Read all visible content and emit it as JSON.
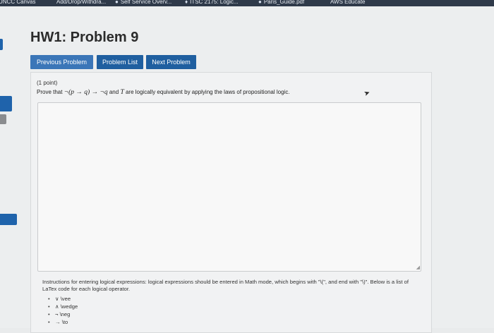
{
  "bookmarks": [
    {
      "label": "UNCC Canvas",
      "icon": "none"
    },
    {
      "label": "Add/Drop/Withdra...",
      "icon": "none"
    },
    {
      "label": "Self Service Overv...",
      "icon": "circle-icon"
    },
    {
      "label": "ITSC 2175: Logic...",
      "icon": "leaf-icon"
    },
    {
      "label": "Paris_Guide.pdf",
      "icon": "circle-icon"
    },
    {
      "label": "AWS Educate",
      "icon": "none"
    }
  ],
  "header": {
    "title": "HW1: Problem 9"
  },
  "nav": {
    "previous": "Previous Problem",
    "list": "Problem List",
    "next": "Next Problem"
  },
  "problem": {
    "points": "(1 point)",
    "prompt_prefix": "Prove that",
    "prompt_expr": "¬(p → q) → ¬q",
    "prompt_and": "and",
    "prompt_T": "T",
    "prompt_suffix": "are logically equivalent by applying the laws of propositional logic."
  },
  "instructions": {
    "text": "Instructions for entering logical expressions: logical expressions should be entered in Math mode, which begins with \"\\(\", and end with \"\\)\". Below is a list of LaTex code for each logical operator.",
    "operators": [
      {
        "symbol": "∨",
        "code": "\\vee"
      },
      {
        "symbol": "∧",
        "code": "\\wedge"
      },
      {
        "symbol": "¬",
        "code": "\\neg"
      },
      {
        "symbol": "→",
        "code": "\\to"
      }
    ]
  },
  "colors": {
    "accent_blue": "#1f63ab",
    "bookmark_bar": "#2f3a4a",
    "nav_button": "#1f5fa0"
  }
}
